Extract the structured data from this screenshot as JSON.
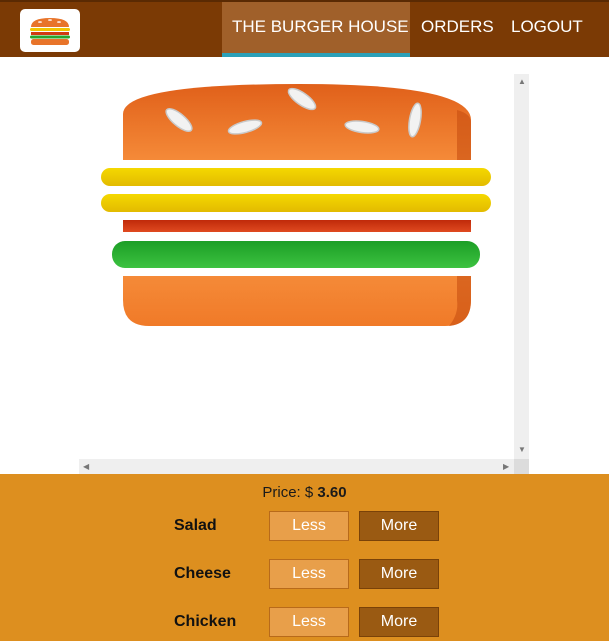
{
  "nav": {
    "logo_icon": "burger-logo-icon",
    "items": [
      {
        "label": "THE BURGER HOUSE",
        "active": true
      },
      {
        "label": "ORDERS",
        "active": false
      },
      {
        "label": "LOGOUT",
        "active": false
      }
    ]
  },
  "price": {
    "label": "Price: $",
    "value": "3.60"
  },
  "ingredients": [
    {
      "name": "Salad",
      "less_label": "Less",
      "more_label": "More"
    },
    {
      "name": "Cheese",
      "less_label": "Less",
      "more_label": "More"
    },
    {
      "name": "Chicken",
      "less_label": "Less",
      "more_label": "More"
    }
  ],
  "colors": {
    "nav_bg": "#7b3a05",
    "nav_active": "#a0602a",
    "nav_active_underline": "#2aa0b8",
    "panel_bg": "#dd8f1f",
    "less_button": "#e89f4a",
    "more_button": "#9a5a12",
    "bun": "#f07a28",
    "cheese": "#f0cc00",
    "meat": "#d23a12",
    "salad": "#22a52c"
  },
  "burger_layers": [
    "top-bun",
    "cheese",
    "cheese",
    "meat",
    "salad",
    "bottom-bun"
  ]
}
